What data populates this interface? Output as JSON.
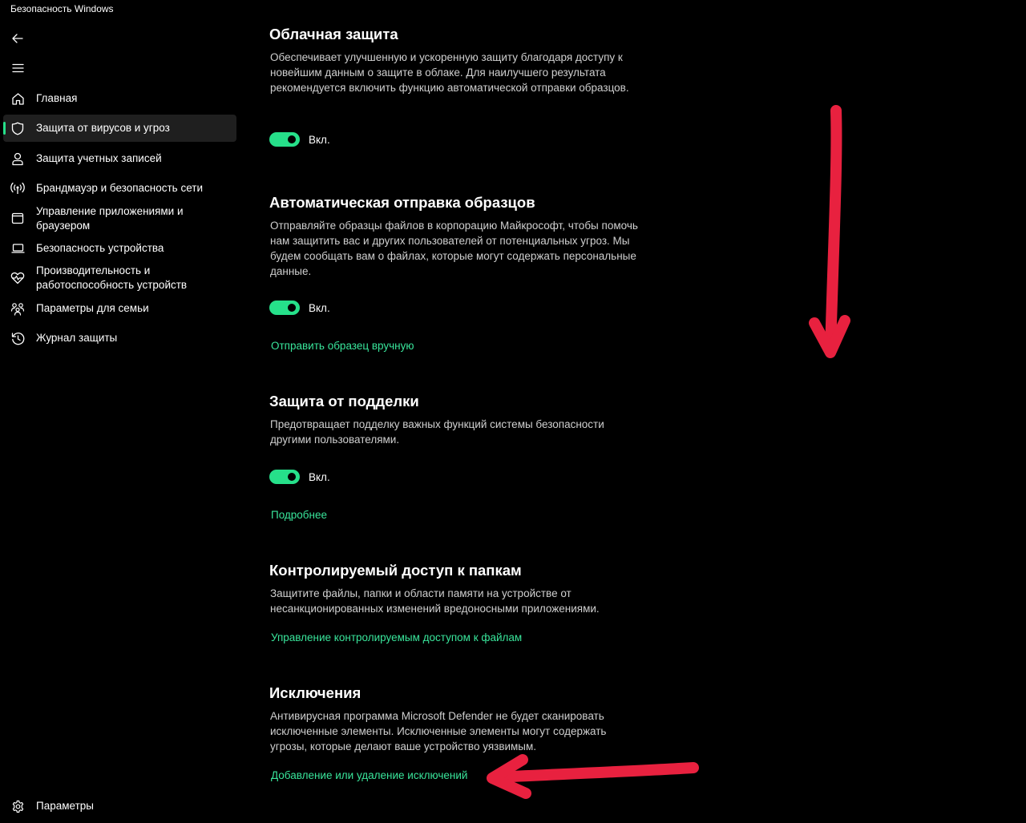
{
  "window": {
    "title": "Безопасность Windows"
  },
  "colors": {
    "accent": "#26e08a",
    "link": "#39e59b",
    "annotation": "#e8213f"
  },
  "sidebar": {
    "back_icon": "back-arrow-icon",
    "menu_icon": "hamburger-menu-icon",
    "items": [
      {
        "label": "Главная",
        "icon": "home-icon"
      },
      {
        "label": "Защита от вирусов и угроз",
        "icon": "shield-icon",
        "active": true
      },
      {
        "label": "Защита учетных записей",
        "icon": "person-icon"
      },
      {
        "label": "Брандмауэр и безопасность сети",
        "icon": "wifi-antenna-icon"
      },
      {
        "label": "Управление приложениями и браузером",
        "icon": "app-window-icon"
      },
      {
        "label": "Безопасность устройства",
        "icon": "laptop-icon"
      },
      {
        "label": "Производительность и работоспособность устройств",
        "icon": "heart-pulse-icon"
      },
      {
        "label": "Параметры для семьи",
        "icon": "family-icon"
      },
      {
        "label": "Журнал защиты",
        "icon": "history-icon"
      }
    ],
    "settings": {
      "label": "Параметры",
      "icon": "gear-icon"
    }
  },
  "main": {
    "cloud": {
      "title": "Облачная защита",
      "description": "Обеспечивает улучшенную и ускоренную защиту благодаря доступу к новейшим данным о защите в облаке. Для наилучшего результата рекомендуется включить функцию автоматической отправки образцов.",
      "toggle_label": "Вкл.",
      "toggle_on": true
    },
    "samples": {
      "title": "Автоматическая отправка образцов",
      "description": "Отправляйте образцы файлов в корпорацию Майкрософт, чтобы помочь нам защитить вас и других пользователей от потенциальных угроз. Мы будем сообщать вам о файлах, которые могут содержать персональные данные.",
      "toggle_label": "Вкл.",
      "toggle_on": true,
      "link": "Отправить образец вручную"
    },
    "tamper": {
      "title": "Защита от подделки",
      "description": "Предотвращает подделку важных функций системы безопасности другими пользователями.",
      "toggle_label": "Вкл.",
      "toggle_on": true,
      "link": "Подробнее"
    },
    "folders": {
      "title": "Контролируемый доступ к папкам",
      "description": "Защитите файлы, папки и области памяти на устройстве от несанкционированных изменений вредоносными приложениями.",
      "link": "Управление контролируемым доступом к файлам"
    },
    "exclusions": {
      "title": "Исключения",
      "description": "Антивирусная программа Microsoft Defender не будет сканировать исключенные элементы. Исключенные элементы могут содержать угрозы, которые делают ваше устройство уязвимым.",
      "link": "Добавление или удаление исключений"
    }
  }
}
